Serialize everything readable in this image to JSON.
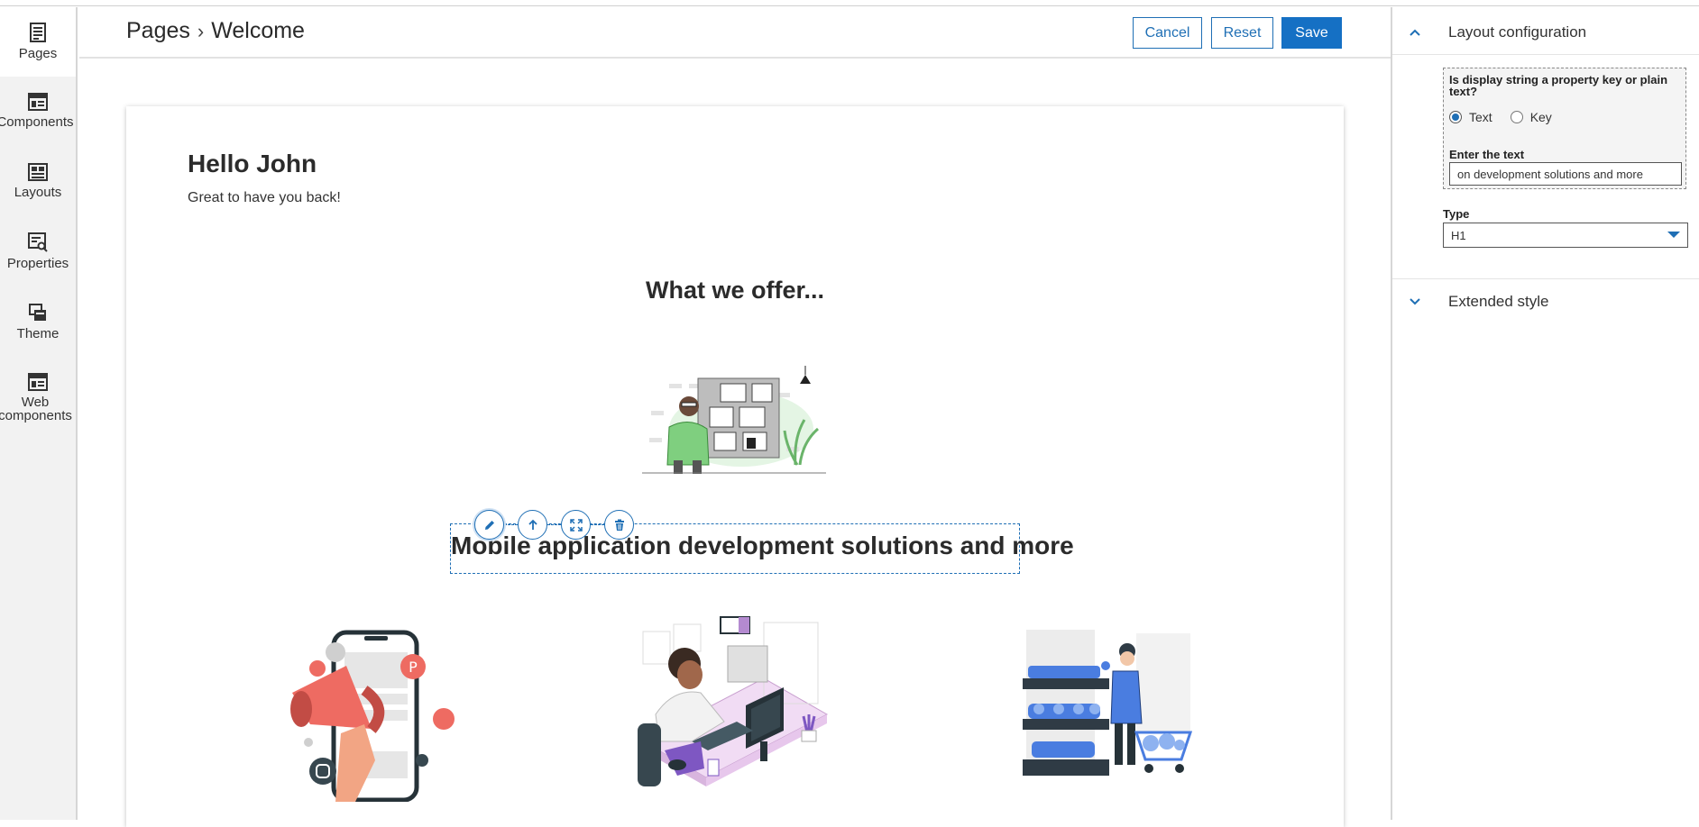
{
  "rail": {
    "items": [
      {
        "label": "Pages"
      },
      {
        "label": "Components"
      },
      {
        "label": "Layouts"
      },
      {
        "label": "Properties"
      },
      {
        "label": "Theme"
      },
      {
        "label": "Web\ncomponents"
      }
    ]
  },
  "header": {
    "crumb_root": "Pages",
    "crumb_sep": "›",
    "crumb_current": "Welcome",
    "cancel_label": "Cancel",
    "reset_label": "Reset",
    "save_label": "Save"
  },
  "page": {
    "greeting": "Hello John",
    "subtitle": "Great to have you back!",
    "offer_heading": "What we offer...",
    "selected_heading": "Mobile application development solutions and more"
  },
  "panel": {
    "layout_config_title": "Layout configuration",
    "question": "Is display string a property key or plain text?",
    "radio_text": "Text",
    "radio_key": "Key",
    "selected_option": "Text",
    "enter_text_label": "Enter the text",
    "enter_text_value": "on development solutions and more",
    "type_label": "Type",
    "type_value": "H1",
    "extended_style_title": "Extended style"
  },
  "colors": {
    "accent": "#1570c4",
    "rail_bg": "#f2f2f2"
  }
}
